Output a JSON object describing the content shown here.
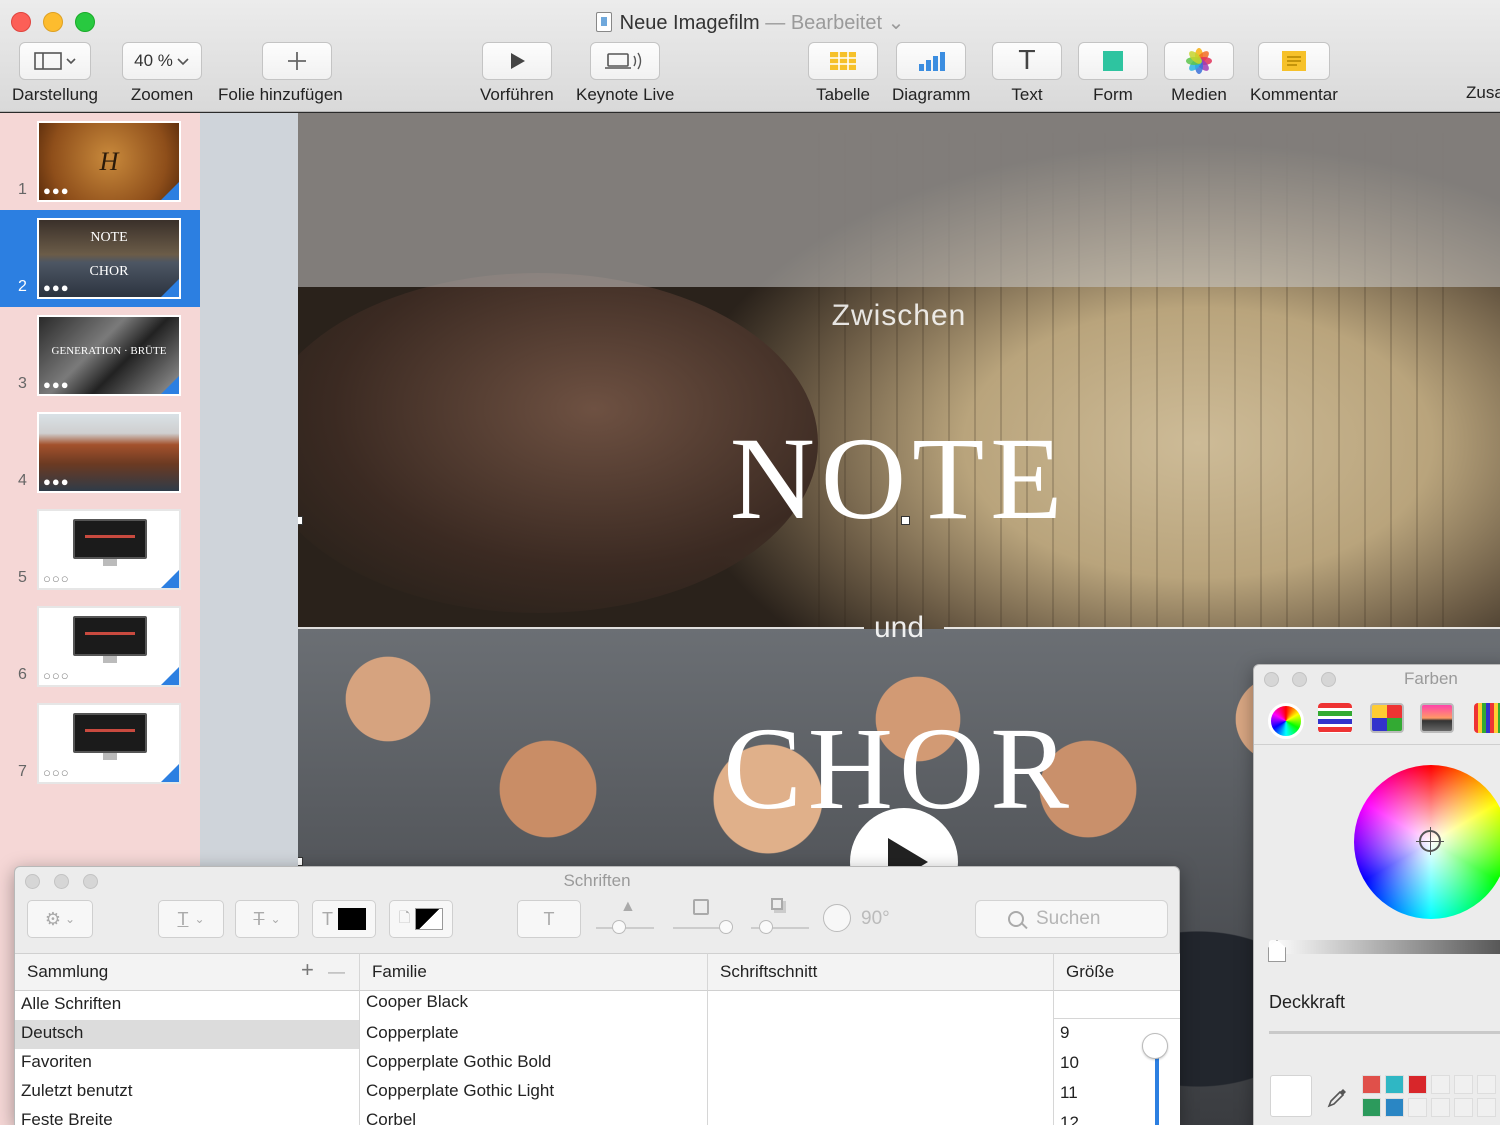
{
  "window": {
    "title": "Neue Imagefilm",
    "separator": "—",
    "status": "Bearbeitet",
    "status_chevron": "⌄"
  },
  "toolbar": {
    "view": {
      "label": "Darstellung",
      "icon": "sidebar-view-icon"
    },
    "zoom": {
      "label": "Zoomen",
      "value": "40 %"
    },
    "add_slide": {
      "label": "Folie hinzufügen",
      "icon": "plus-icon"
    },
    "play": {
      "label": "Vorführen",
      "icon": "play-icon"
    },
    "keynote_live": {
      "label": "Keynote Live",
      "icon": "live-icon"
    },
    "table": {
      "label": "Tabelle",
      "color": "#f6c12a"
    },
    "chart": {
      "label": "Diagramm",
      "color": "#3b8de0"
    },
    "text": {
      "label": "Text",
      "glyph": "T"
    },
    "shape": {
      "label": "Form",
      "color": "#2ec4a0"
    },
    "media": {
      "label": "Medien",
      "icon": "photos-icon"
    },
    "comment": {
      "label": "Kommentar",
      "color": "#f6c12a"
    },
    "overflow": {
      "label": "Zusa"
    }
  },
  "navigator": {
    "selected_index": 2,
    "slides": [
      {
        "number": "1",
        "thumb_text": "H"
      },
      {
        "number": "2",
        "thumb_text": "NOTE",
        "thumb_text2": "CHOR"
      },
      {
        "number": "3",
        "thumb_text": "GENERATION · BRÜTE"
      },
      {
        "number": "4"
      },
      {
        "number": "5"
      },
      {
        "number": "6"
      },
      {
        "number": "7"
      }
    ]
  },
  "slide": {
    "line1": "Zwischen",
    "line2": "NOTE",
    "line3": "und",
    "line4": "CHOR"
  },
  "fonts_panel": {
    "title": "Schriften",
    "rotation": "90°",
    "search_placeholder": "Suchen",
    "text_glyph": "T",
    "strike_glyph": "T",
    "columns": {
      "collection": "Sammlung",
      "collection_add": "+",
      "collection_remove": "—",
      "family": "Familie",
      "typeface": "Schriftschnitt",
      "size": "Größe"
    },
    "collections": [
      "Alle Schriften",
      "Deutsch",
      "Favoriten",
      "Zuletzt benutzt",
      "Feste Breite"
    ],
    "selected_collection": "Deutsch",
    "families": [
      "Cooper Black",
      "Copperplate",
      "Copperplate Gothic Bold",
      "Copperplate Gothic Light",
      "Corbel"
    ],
    "sizes": [
      "9",
      "10",
      "11",
      "12"
    ]
  },
  "colors_panel": {
    "title": "Farben",
    "opacity_label": "Deckkraft",
    "palette": [
      "#e0504a",
      "#2fb7c4",
      "#d8262a",
      "#2c9a5c",
      "#2a86c4"
    ]
  }
}
